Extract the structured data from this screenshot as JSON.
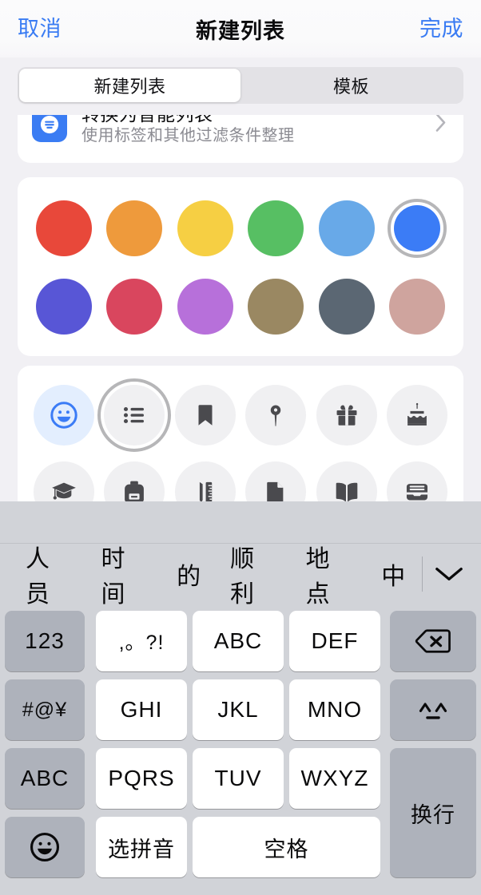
{
  "navbar": {
    "cancel_label": "取消",
    "title": "新建列表",
    "done_label": "完成"
  },
  "segmented_control": {
    "selected_index": 0,
    "options": [
      {
        "label": "新建列表"
      },
      {
        "label": "模板"
      }
    ]
  },
  "smart_list_row": {
    "title": "转换为智能列表",
    "subtitle": "使用标签和其他过滤条件整理",
    "icon": "smart-list-icon",
    "accessory": "chevron-right-icon",
    "icon_color": "#3A7CF3"
  },
  "color_picker": {
    "selected_index": 5,
    "rows": [
      [
        {
          "name": "red",
          "hex": "#E8483A"
        },
        {
          "name": "orange",
          "hex": "#EE9A3C"
        },
        {
          "name": "yellow",
          "hex": "#F6CF43"
        },
        {
          "name": "green",
          "hex": "#57BF63"
        },
        {
          "name": "light-blue",
          "hex": "#68A9E8"
        },
        {
          "name": "blue",
          "hex": "#3B7CF6"
        }
      ],
      [
        {
          "name": "indigo",
          "hex": "#5856D6"
        },
        {
          "name": "crimson",
          "hex": "#D9465E"
        },
        {
          "name": "purple",
          "hex": "#B770DA"
        },
        {
          "name": "brown",
          "hex": "#9A8862"
        },
        {
          "name": "slate",
          "hex": "#5B6773"
        },
        {
          "name": "dusty-rose",
          "hex": "#CFA49E"
        }
      ]
    ],
    "selection_ring_color": "#B6B6B8"
  },
  "icon_picker": {
    "selected_index": 1,
    "rows": [
      [
        {
          "name": "smiley-icon",
          "tinted": true
        },
        {
          "name": "list-icon",
          "tinted": false
        },
        {
          "name": "bookmark-icon",
          "tinted": false
        },
        {
          "name": "pin-icon",
          "tinted": false
        },
        {
          "name": "gift-icon",
          "tinted": false
        },
        {
          "name": "cake-icon",
          "tinted": false
        }
      ],
      [
        {
          "name": "graduation-cap-icon",
          "tinted": false
        },
        {
          "name": "backpack-icon",
          "tinted": false
        },
        {
          "name": "ruler-pencil-icon",
          "tinted": false
        },
        {
          "name": "document-icon",
          "tinted": false
        },
        {
          "name": "book-icon",
          "tinted": false
        },
        {
          "name": "wallet-icon",
          "tinted": false
        }
      ]
    ],
    "tint_background": "#E3EEFE",
    "tint_color": "#3B7CF6"
  },
  "keyboard": {
    "suggestions": [
      "人员",
      "时间",
      "的",
      "顺利",
      "地点",
      "中"
    ],
    "collapse_icon": "chevron-down-icon",
    "keys": {
      "num": "123",
      "punct": ",。?!",
      "abc": "ABC",
      "def": "DEF",
      "delete_icon": "delete-backspace-icon",
      "symbols": "#@¥",
      "ghi": "GHI",
      "jkl": "JKL",
      "mno": "MNO",
      "kaomoji": "^^",
      "abc_mode": "ABC",
      "pqrs": "PQRS",
      "tuv": "TUV",
      "wxyz": "WXYZ",
      "emoji_icon": "emoji-smiley-icon",
      "pinyin": "选拼音",
      "space": "空格",
      "return": "换行"
    }
  }
}
